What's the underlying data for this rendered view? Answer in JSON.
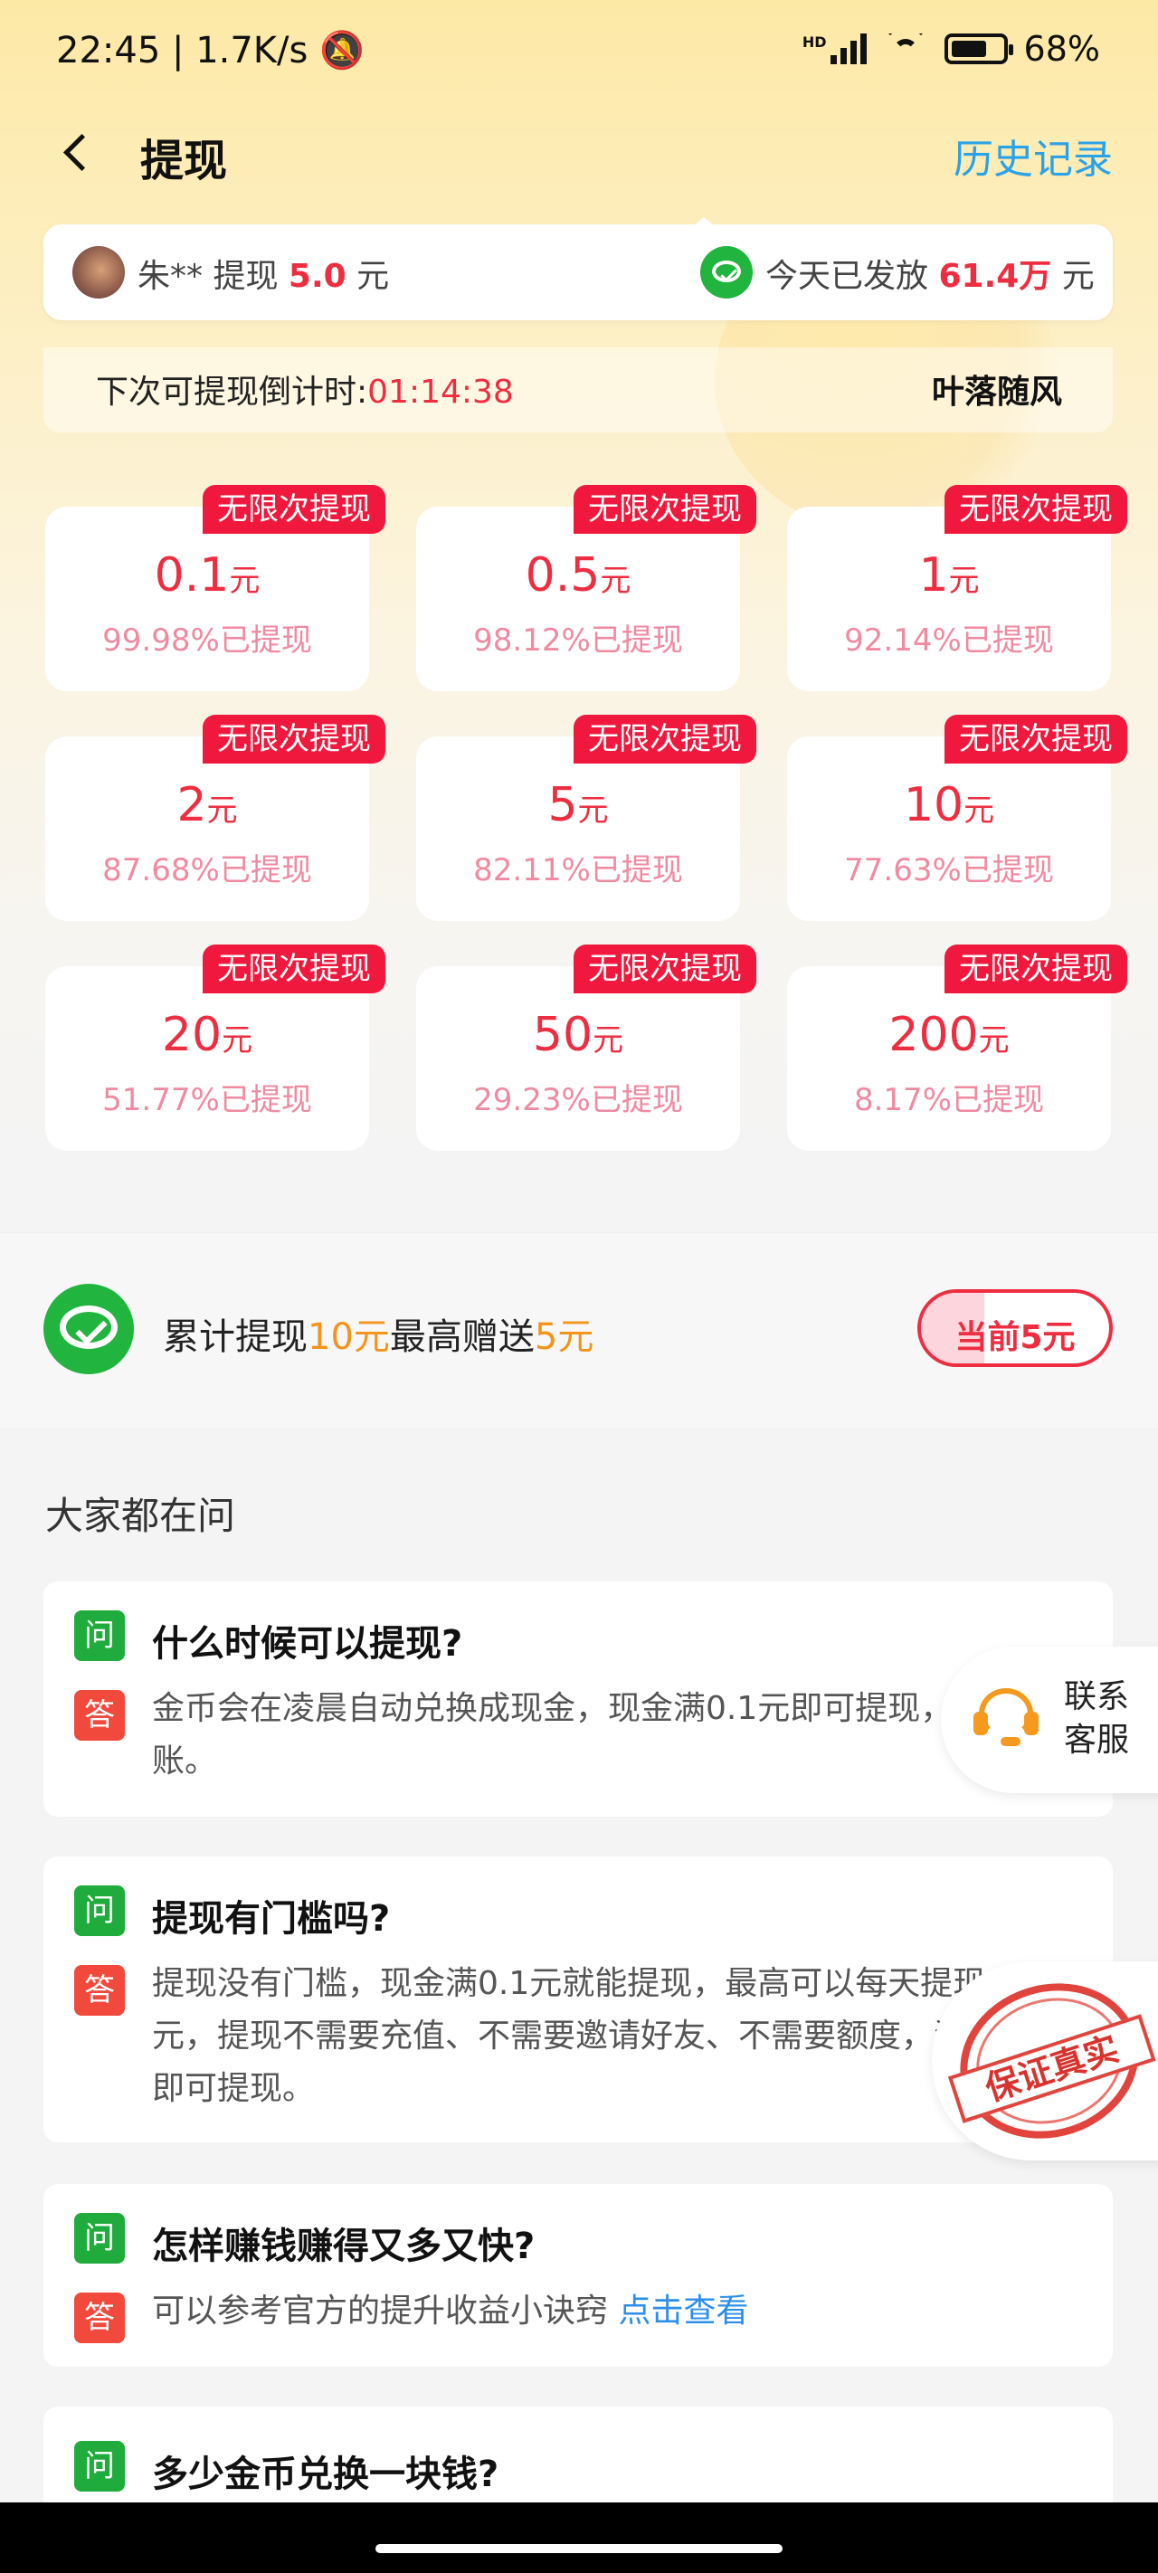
{
  "status_bar": {
    "time": "22:45",
    "net_speed": "1.7K/s",
    "battery_pct": "68%",
    "hd_label": "HD"
  },
  "header": {
    "title": "提现",
    "history": "历史记录"
  },
  "ticker": {
    "user": "朱** 提现",
    "amount": "5.0",
    "unit": "元",
    "today_prefix": "今天已发放",
    "today_amount": "61.4万",
    "today_unit": "元"
  },
  "countdown": {
    "label": "下次可提现倒计时:",
    "time": "01:14:38",
    "username": "叶落随风"
  },
  "options": [
    {
      "badge": "无限次提现",
      "amount": "0.1",
      "unit": "元",
      "pct": "99.98%已提现"
    },
    {
      "badge": "无限次提现",
      "amount": "0.5",
      "unit": "元",
      "pct": "98.12%已提现"
    },
    {
      "badge": "无限次提现",
      "amount": "1",
      "unit": "元",
      "pct": "92.14%已提现"
    },
    {
      "badge": "无限次提现",
      "amount": "2",
      "unit": "元",
      "pct": "87.68%已提现"
    },
    {
      "badge": "无限次提现",
      "amount": "5",
      "unit": "元",
      "pct": "82.11%已提现"
    },
    {
      "badge": "无限次提现",
      "amount": "10",
      "unit": "元",
      "pct": "77.63%已提现"
    },
    {
      "badge": "无限次提现",
      "amount": "20",
      "unit": "元",
      "pct": "51.77%已提现"
    },
    {
      "badge": "无限次提现",
      "amount": "50",
      "unit": "元",
      "pct": "29.23%已提现"
    },
    {
      "badge": "无限次提现",
      "amount": "200",
      "unit": "元",
      "pct": "8.17%已提现"
    }
  ],
  "bonus": {
    "text1": "累计提现",
    "amount1": "10元",
    "text2": "最高赠送",
    "amount2": "5元",
    "button": "当前5元"
  },
  "faq": {
    "title": "大家都在问",
    "q_tag": "问",
    "a_tag": "答",
    "items": [
      {
        "q": "什么时候可以提现?",
        "a": "金币会在凌晨自动兑换成现金，现金满0.1元即可提现，秒到账。"
      },
      {
        "q": "提现有门槛吗?",
        "a": "提现没有门槛，现金满0.1元就能提现，最高可以每天提现200元，提现不需要充值、不需要邀请好友、不需要额度，满0.1元即可提现。"
      },
      {
        "q": "怎样赚钱赚得又多又快?",
        "a": "可以参考官方的提升收益小诀窍",
        "link": "点击查看"
      },
      {
        "q": "多少金币兑换一块钱?"
      }
    ]
  },
  "floating": {
    "customer_service": "联系客服",
    "stamp": "保证真实"
  }
}
